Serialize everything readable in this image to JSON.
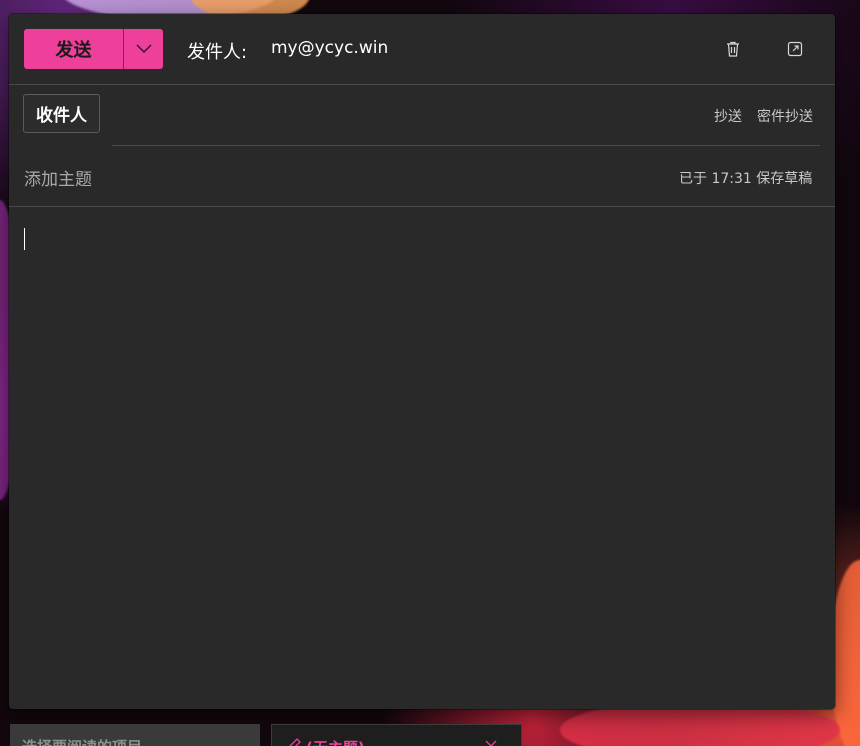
{
  "toolbar": {
    "send_label": "发送",
    "from_label": "发件人:",
    "from_address": "my@ycyc.win",
    "more_icon": "chevron-down-icon",
    "delete_icon": "trash-icon",
    "popout_icon": "popout-icon"
  },
  "recipients": {
    "to_label": "收件人",
    "cc_label": "抄送",
    "bcc_label": "密件抄送"
  },
  "subject": {
    "placeholder": "添加主题",
    "status": "已于 17:31 保存草稿"
  },
  "background_panels": {
    "list_hint": "选择要阅读的项目",
    "draft_tab": "(无主题)"
  },
  "colors": {
    "accent": "#ee3f9b",
    "panel": "#292929"
  }
}
